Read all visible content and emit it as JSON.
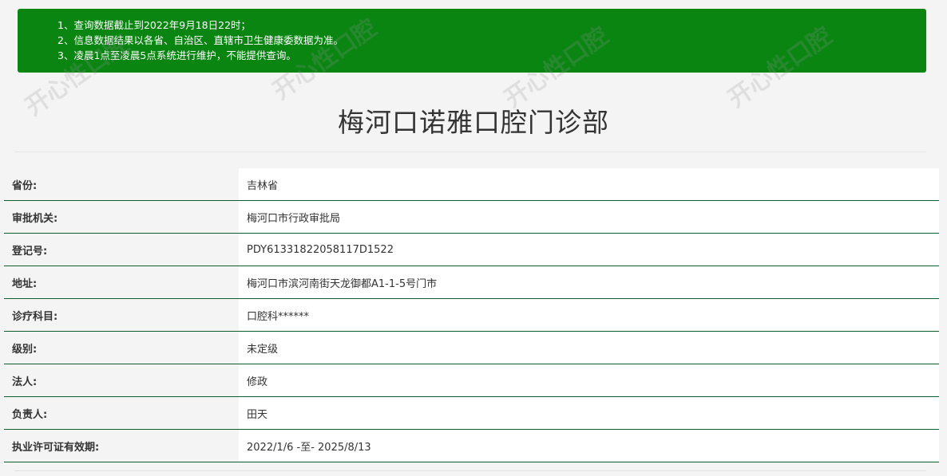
{
  "notice": {
    "lines": [
      "1、查询数据截止到2022年9月18日22时；",
      "2、信息数据结果以各省、自治区、直辖市卫生健康委数据为准。",
      "3、凌晨1点至凌晨5点系统进行维护，不能提供查询。"
    ]
  },
  "title": "梅河口诺雅口腔门诊部",
  "rows": [
    {
      "label": "省份:",
      "value": "吉林省"
    },
    {
      "label": "审批机关:",
      "value": "梅河口市行政审批局"
    },
    {
      "label": "登记号:",
      "value": "PDY61331822058117D1522"
    },
    {
      "label": "地址:",
      "value": "梅河口市滨河南街天龙御都A1-1-5号门市"
    },
    {
      "label": "诊疗科目:",
      "value": "口腔科******"
    },
    {
      "label": "级别:",
      "value": "未定级"
    },
    {
      "label": "法人:",
      "value": "修政"
    },
    {
      "label": "负责人:",
      "value": "田天"
    },
    {
      "label": "执业许可证有效期:",
      "value": "2022/1/6 -至- 2025/8/13"
    }
  ],
  "watermark": {
    "text": "开心性口腔"
  }
}
